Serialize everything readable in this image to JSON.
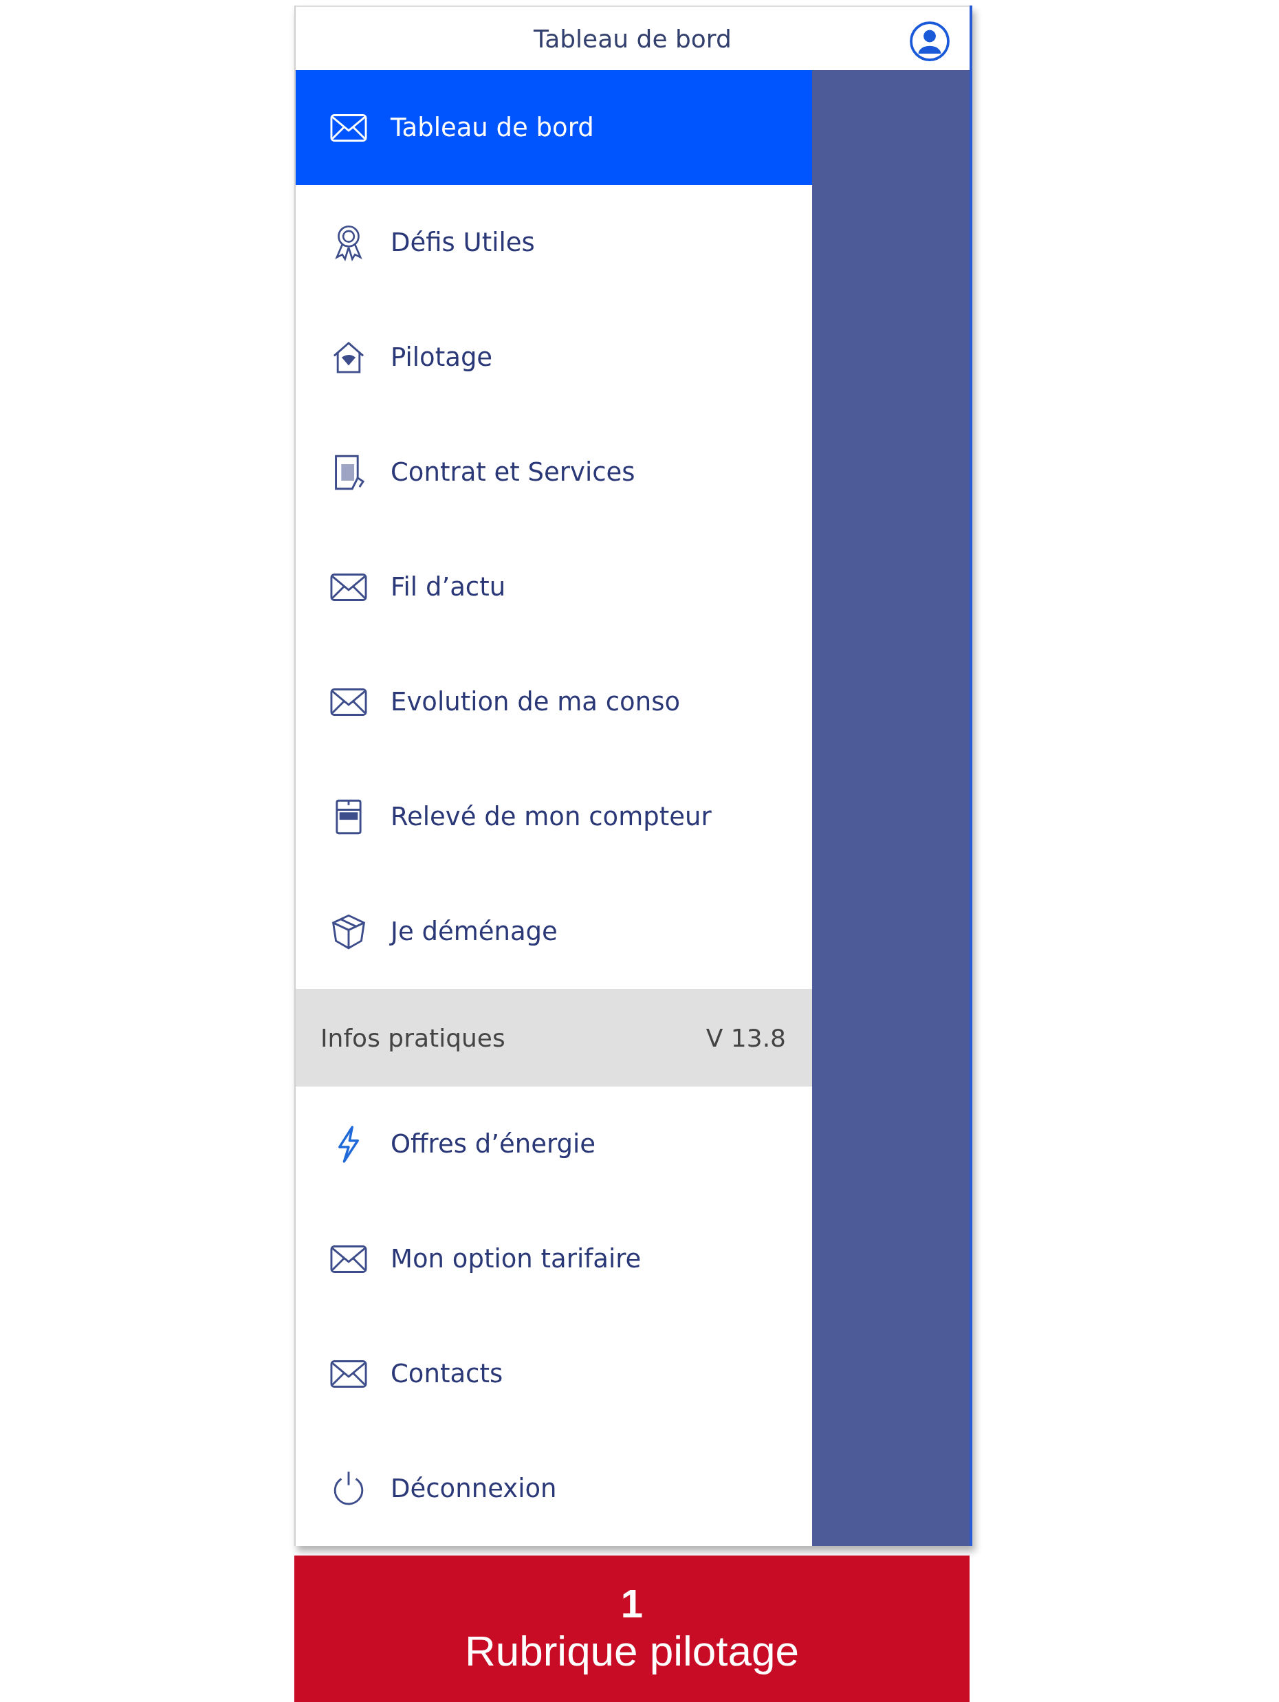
{
  "header": {
    "title": "Tableau de bord"
  },
  "menu": {
    "items": [
      {
        "label": "Tableau de bord",
        "selected": true
      },
      {
        "label": "Défis Utiles",
        "selected": false
      },
      {
        "label": "Pilotage",
        "selected": false
      },
      {
        "label": "Contrat et Services",
        "selected": false
      },
      {
        "label": "Fil d’actu",
        "selected": false
      },
      {
        "label": "Evolution de ma conso",
        "selected": false
      },
      {
        "label": "Relevé de mon compteur",
        "selected": false
      },
      {
        "label": "Je déménage",
        "selected": false
      }
    ]
  },
  "section": {
    "title": "Infos pratiques",
    "version": "V 13.8"
  },
  "more_items": [
    {
      "label": "Offres d’énergie",
      "selected": false
    },
    {
      "label": "Mon option tarifaire",
      "selected": false
    },
    {
      "label": "Contacts",
      "selected": false
    },
    {
      "label": "Déconnexion",
      "selected": false
    }
  ],
  "caption": {
    "number": "1",
    "text": "Rubrique pilotage"
  }
}
